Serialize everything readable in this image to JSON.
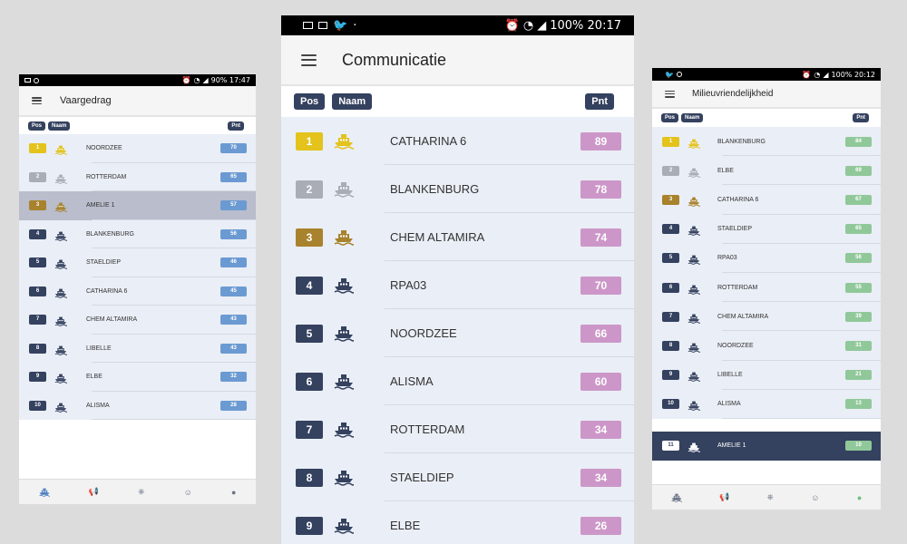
{
  "colors": {
    "gold": "#e3c31c",
    "silver": "#a9adb6",
    "bronze": "#a8822c",
    "navy": "#34415f",
    "score_blue": "#6b9ad2",
    "score_pink": "#cc97c8",
    "score_green": "#90c89a"
  },
  "phones": [
    {
      "status": {
        "right": "90% 17:47"
      },
      "title": "Vaargedrag",
      "headers": {
        "pos": "Pos",
        "name": "Naam",
        "points": "Pnt"
      },
      "highlight_pos": "3",
      "score_color": "#6b9ad2",
      "rows": [
        {
          "pos": "1",
          "name": "NOORDZEE",
          "points": "70"
        },
        {
          "pos": "2",
          "name": "ROTTERDAM",
          "points": "65"
        },
        {
          "pos": "3",
          "name": "AMELIE 1",
          "points": "57"
        },
        {
          "pos": "4",
          "name": "BLANKENBURG",
          "points": "56"
        },
        {
          "pos": "5",
          "name": "STAELDIEP",
          "points": "46"
        },
        {
          "pos": "6",
          "name": "CATHARINA 6",
          "points": "45"
        },
        {
          "pos": "7",
          "name": "CHEM ALTAMIRA",
          "points": "43"
        },
        {
          "pos": "8",
          "name": "LIBELLE",
          "points": "43"
        },
        {
          "pos": "9",
          "name": "ELBE",
          "points": "32"
        },
        {
          "pos": "10",
          "name": "ALISMA",
          "points": "28"
        }
      ],
      "nav": [
        "ship-tab-icon",
        "megaphone-tab-icon",
        "steering-wheel-tab-icon",
        "smiley-tab-icon",
        "leaf-tab-icon"
      ]
    },
    {
      "status": {
        "right": "100% 20:17"
      },
      "title": "Communicatie",
      "headers": {
        "pos": "Pos",
        "name": "Naam",
        "points": "Pnt"
      },
      "score_color": "#cc97c8",
      "rows": [
        {
          "pos": "1",
          "name": "CATHARINA 6",
          "points": "89"
        },
        {
          "pos": "2",
          "name": "BLANKENBURG",
          "points": "78"
        },
        {
          "pos": "3",
          "name": "CHEM ALTAMIRA",
          "points": "74"
        },
        {
          "pos": "4",
          "name": "RPA03",
          "points": "70"
        },
        {
          "pos": "5",
          "name": "NOORDZEE",
          "points": "66"
        },
        {
          "pos": "6",
          "name": "ALISMA",
          "points": "60"
        },
        {
          "pos": "7",
          "name": "ROTTERDAM",
          "points": "34"
        },
        {
          "pos": "8",
          "name": "STAELDIEP",
          "points": "34"
        },
        {
          "pos": "9",
          "name": "ELBE",
          "points": "26"
        }
      ]
    },
    {
      "status": {
        "right": "100% 20:12"
      },
      "title": "Milieuvriendelijkheid",
      "headers": {
        "pos": "Pos",
        "name": "Naam",
        "points": "Pnt"
      },
      "score_color": "#90c89a",
      "rows": [
        {
          "pos": "1",
          "name": "BLANKENBURG",
          "points": "84"
        },
        {
          "pos": "2",
          "name": "ELBE",
          "points": "69"
        },
        {
          "pos": "3",
          "name": "CATHARINA 6",
          "points": "67"
        },
        {
          "pos": "4",
          "name": "STAELDIEP",
          "points": "65"
        },
        {
          "pos": "5",
          "name": "RPA03",
          "points": "56"
        },
        {
          "pos": "6",
          "name": "ROTTERDAM",
          "points": "55"
        },
        {
          "pos": "7",
          "name": "CHEM ALTAMIRA",
          "points": "39"
        },
        {
          "pos": "8",
          "name": "NOORDZEE",
          "points": "31"
        },
        {
          "pos": "9",
          "name": "LIBELLE",
          "points": "21"
        },
        {
          "pos": "10",
          "name": "ALISMA",
          "points": "13"
        }
      ],
      "self_row": {
        "pos": "11",
        "name": "AMELIE 1",
        "points": "10"
      },
      "nav": [
        "ship-tab-icon",
        "megaphone-tab-icon",
        "steering-wheel-tab-icon",
        "smiley-tab-icon",
        "leaf-tab-icon"
      ]
    }
  ]
}
